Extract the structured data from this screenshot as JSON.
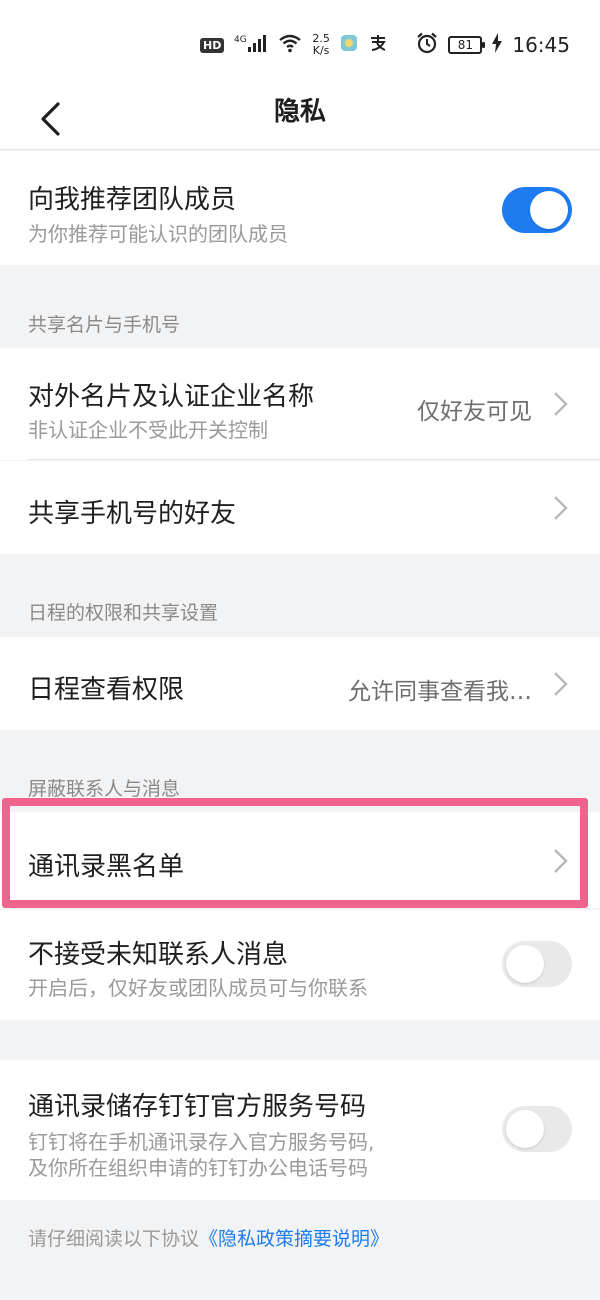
{
  "status_bar": {
    "hd": "HD",
    "signal_label": "4G",
    "speed_value": "2.5",
    "speed_unit": "K/s",
    "battery": "81",
    "time": "16:45"
  },
  "nav": {
    "title": "隐私"
  },
  "recommend": {
    "title": "向我推荐团队成员",
    "subtitle": "为你推荐可能认识的团队成员",
    "enabled": true
  },
  "section_share": {
    "header": "共享名片与手机号",
    "items": [
      {
        "title": "对外名片及认证企业名称",
        "subtitle": "非认证企业不受此开关控制",
        "value": "仅好友可见"
      },
      {
        "title": "共享手机号的好友"
      }
    ]
  },
  "section_calendar": {
    "header": "日程的权限和共享设置",
    "items": [
      {
        "title": "日程查看权限",
        "value": "允许同事查看我…"
      }
    ]
  },
  "section_block": {
    "header": "屏蔽联系人与消息",
    "blacklist": {
      "title": "通讯录黑名单"
    },
    "unknown": {
      "title": "不接受未知联系人消息",
      "subtitle": "开启后，仅好友或团队成员可与你联系",
      "enabled": false
    }
  },
  "section_store": {
    "title": "通讯录储存钉钉官方服务号码",
    "subtitle_line1": "钉钉将在手机通讯录存入官方服务号码,",
    "subtitle_line2": "及你所在组织申请的钉钉办公电话号码",
    "enabled": false
  },
  "footer": {
    "text": "请仔细阅读以下协议",
    "link": "《隐私政策摘要说明》"
  },
  "colors": {
    "accent": "#1e7cf0",
    "highlight": "#f0638d"
  }
}
